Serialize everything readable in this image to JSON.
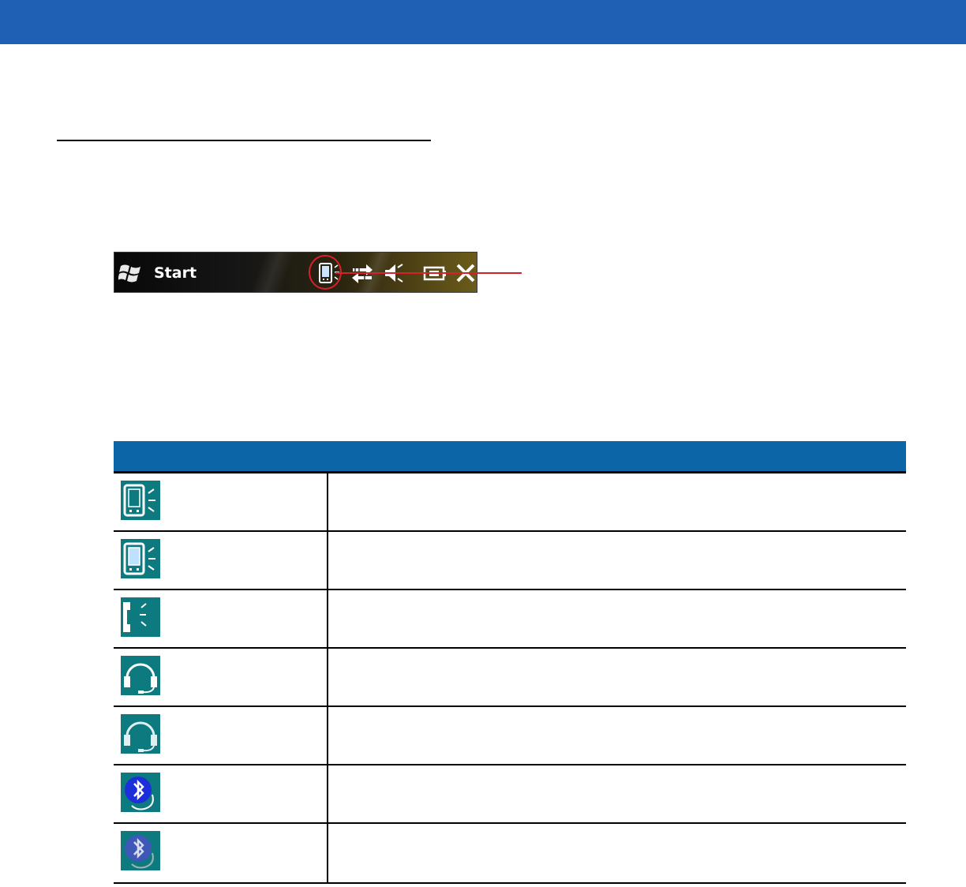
{
  "document": {
    "header_band_color": "#1f5fb4",
    "accent_red": "#d8202a"
  },
  "taskbar": {
    "start_label": "Start",
    "icons": [
      "windows-logo-icon",
      "bluetooth-device-status-icon",
      "connectivity-arrows-icon",
      "speaker-muted-icon",
      "battery-charging-icon",
      "close-icon"
    ]
  },
  "status_table": {
    "header_color": "#0b65a6",
    "headers": [
      "",
      ""
    ],
    "rows": [
      {
        "icon": "pda-device-icon",
        "description": ""
      },
      {
        "icon": "pda-device-light-icon",
        "description": ""
      },
      {
        "icon": "phone-handset-icon",
        "description": ""
      },
      {
        "icon": "headset-icon",
        "description": ""
      },
      {
        "icon": "headset-light-icon",
        "description": ""
      },
      {
        "icon": "bluetooth-icon",
        "description": ""
      },
      {
        "icon": "bluetooth-dim-icon",
        "description": ""
      }
    ]
  }
}
